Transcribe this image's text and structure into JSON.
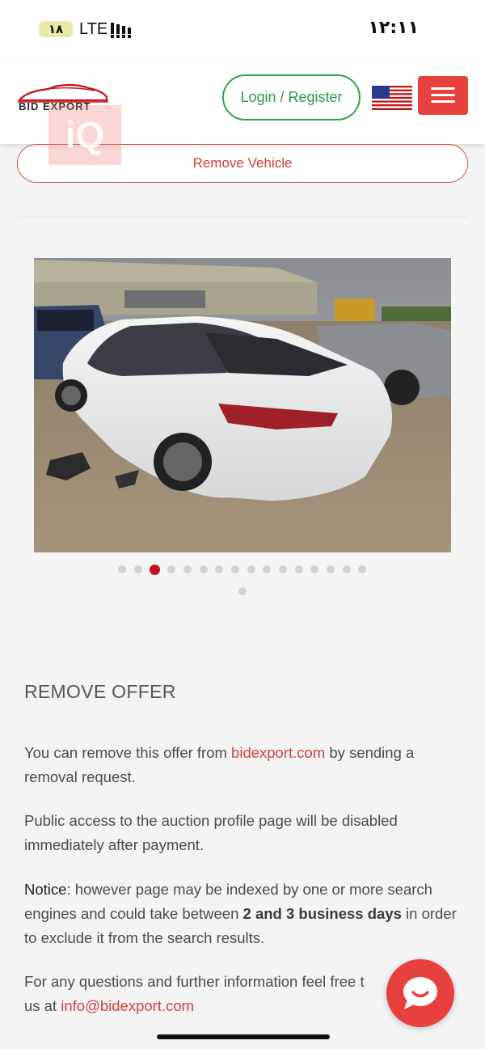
{
  "status_bar": {
    "battery": "۱۸",
    "network": "LTE",
    "time": "۱۲:۱۱"
  },
  "header": {
    "logo_text": "BID EXPORT",
    "login_label": "Login / Register",
    "flag": "us-flag-icon",
    "menu": "hamburger-menu-icon"
  },
  "watermark": "iQ",
  "vehicle": {
    "remove_button": "Remove Vehicle",
    "gallery": {
      "total_images": 17,
      "active_index": 2
    }
  },
  "remove_offer": {
    "title": "REMOVE OFFER",
    "p1": {
      "before": "You can remove this offer from ",
      "link": "bidexport.com",
      "after": " by sending a removal request."
    },
    "p2": "Public access to the auction profile page will be disabled immediately after payment.",
    "p3": {
      "label": "Notice",
      "text1": ": however page may be indexed by one or more search engines and could take between ",
      "bold": "2 and 3 business days",
      "text2": " in order to exclude it from the search results."
    },
    "p4": {
      "before": "For any questions and further information feel free t",
      "middle": "us at ",
      "link": "info@bidexport.com"
    }
  },
  "colors": {
    "accent_red": "#e8403d",
    "login_green": "#2ea24a",
    "link_red": "#d2403b"
  }
}
